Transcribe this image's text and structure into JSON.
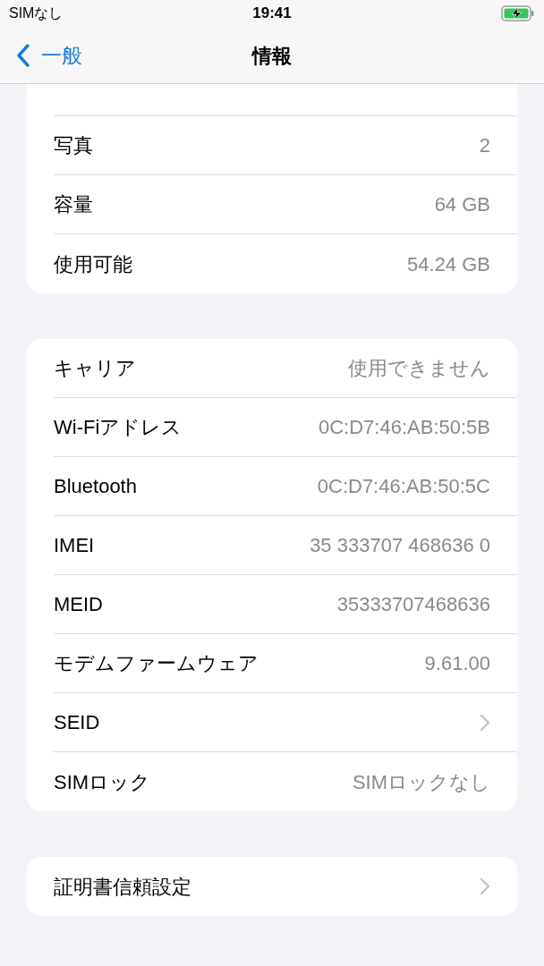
{
  "status_bar": {
    "carrier": "SIMなし",
    "time": "19:41",
    "battery_charging": true
  },
  "nav_bar": {
    "back": "一般",
    "title": "情報"
  },
  "sections": [
    {
      "rows": [
        {
          "kind": "value",
          "label": "写真",
          "value": "2"
        },
        {
          "kind": "value",
          "label": "容量",
          "value": "64 GB"
        },
        {
          "kind": "value",
          "label": "使用可能",
          "value": "54.24 GB"
        }
      ]
    },
    {
      "rows": [
        {
          "kind": "value",
          "label": "キャリア",
          "value": "使用できません"
        },
        {
          "kind": "value",
          "label": "Wi-Fiアドレス",
          "value": "0C:D7:46:AB:50:5B"
        },
        {
          "kind": "value",
          "label": "Bluetooth",
          "value": "0C:D7:46:AB:50:5C"
        },
        {
          "kind": "value",
          "label": "IMEI",
          "value": "35 333707 468636 0"
        },
        {
          "kind": "value",
          "label": "MEID",
          "value": "35333707468636"
        },
        {
          "kind": "value",
          "label": "モデムファームウェア",
          "value": "9.61.00"
        },
        {
          "kind": "disclosure",
          "label": "SEID"
        },
        {
          "kind": "value",
          "label": "SIMロック",
          "value": "SIMロックなし"
        }
      ]
    },
    {
      "rows": [
        {
          "kind": "disclosure",
          "label": "証明書信頼設定"
        }
      ]
    }
  ]
}
